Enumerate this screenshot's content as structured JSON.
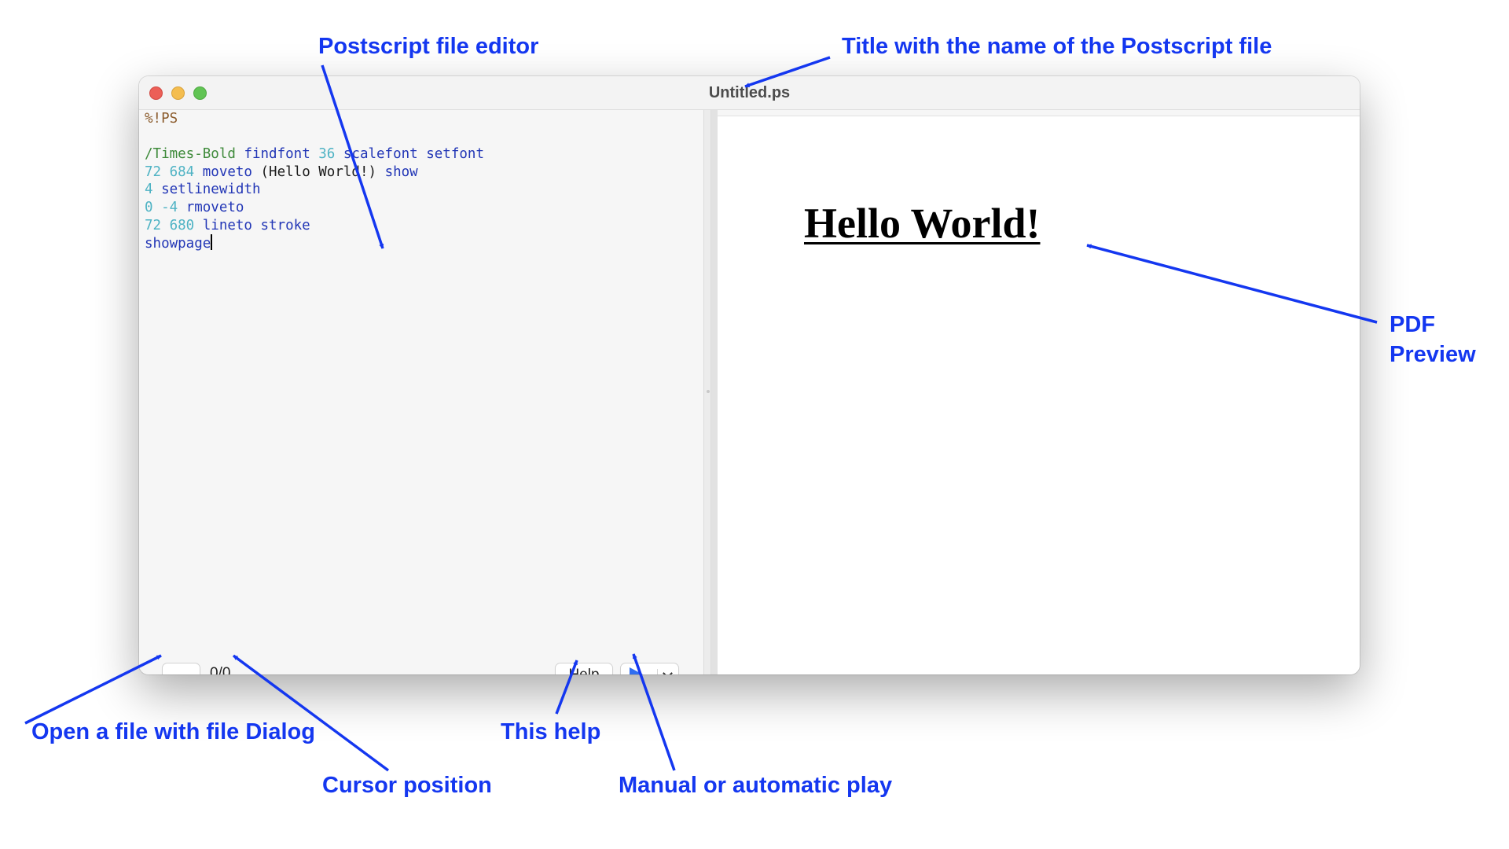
{
  "window": {
    "title": "Untitled.ps"
  },
  "editor": {
    "lines": [
      [
        {
          "t": "%!PS",
          "k": "comment"
        }
      ],
      [],
      [
        {
          "t": "/Times-Bold",
          "k": "name"
        },
        {
          "t": " findfont ",
          "k": "op"
        },
        {
          "t": "36",
          "k": "num"
        },
        {
          "t": " scalefont setfont",
          "k": "op"
        }
      ],
      [
        {
          "t": "72 684",
          "k": "num"
        },
        {
          "t": " moveto ",
          "k": "op"
        },
        {
          "t": "(Hello World!)",
          "k": "str"
        },
        {
          "t": " show",
          "k": "op"
        }
      ],
      [
        {
          "t": "4",
          "k": "num"
        },
        {
          "t": " setlinewidth",
          "k": "op"
        }
      ],
      [
        {
          "t": "0 -4",
          "k": "num"
        },
        {
          "t": " rmoveto",
          "k": "op"
        }
      ],
      [
        {
          "t": "72 680",
          "k": "num"
        },
        {
          "t": " lineto stroke",
          "k": "op"
        }
      ],
      [
        {
          "t": "showpage",
          "k": "op",
          "caret": true
        }
      ]
    ],
    "open_button": "...",
    "cursor_position": "0/0",
    "help_button": "Help"
  },
  "preview": {
    "text": "Hello World!"
  },
  "annotations": {
    "editor": "Postscript file editor",
    "title": "Title with the name of the Postscript file",
    "preview_line1": "PDF",
    "preview_line2": "Preview",
    "open": "Open a file with file Dialog",
    "help": "This help",
    "cursor": "Cursor position",
    "play": "Manual or automatic play"
  },
  "colors": {
    "annotation": "#1437f0",
    "play": "#2f6df0"
  },
  "icons": {
    "play": "play-icon",
    "dropdown": "chevron-down-icon"
  }
}
